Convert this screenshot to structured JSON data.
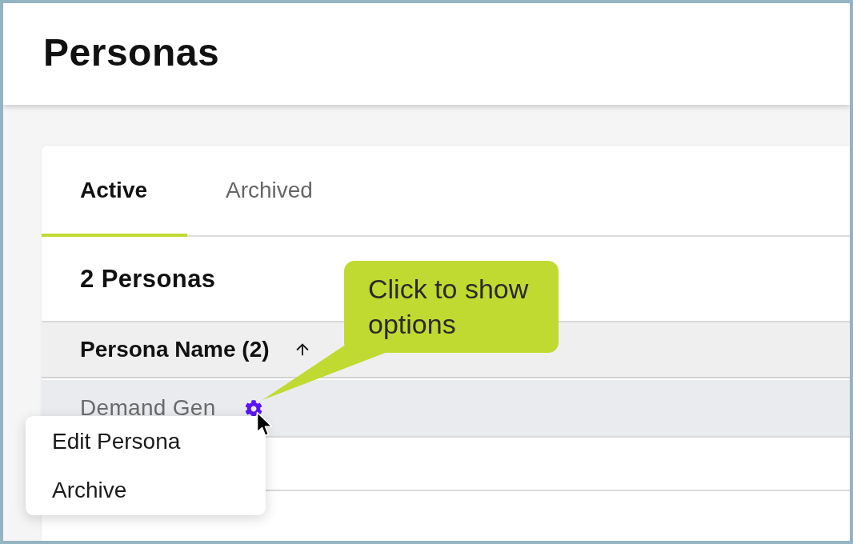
{
  "page": {
    "title": "Personas"
  },
  "tabs": [
    {
      "label": "Active",
      "selected": true
    },
    {
      "label": "Archived",
      "selected": false
    }
  ],
  "count_label": "2 Personas",
  "table": {
    "columns": [
      {
        "label": "Persona Name (2)",
        "sort_ascending": true
      }
    ],
    "rows": [
      {
        "name": "Demand Gen",
        "highlighted": true
      },
      {
        "highlighted": false
      }
    ]
  },
  "context_menu": {
    "items": [
      {
        "label": "Edit Persona"
      },
      {
        "label": "Archive"
      }
    ]
  },
  "callout": {
    "text": "Click to show options"
  }
}
